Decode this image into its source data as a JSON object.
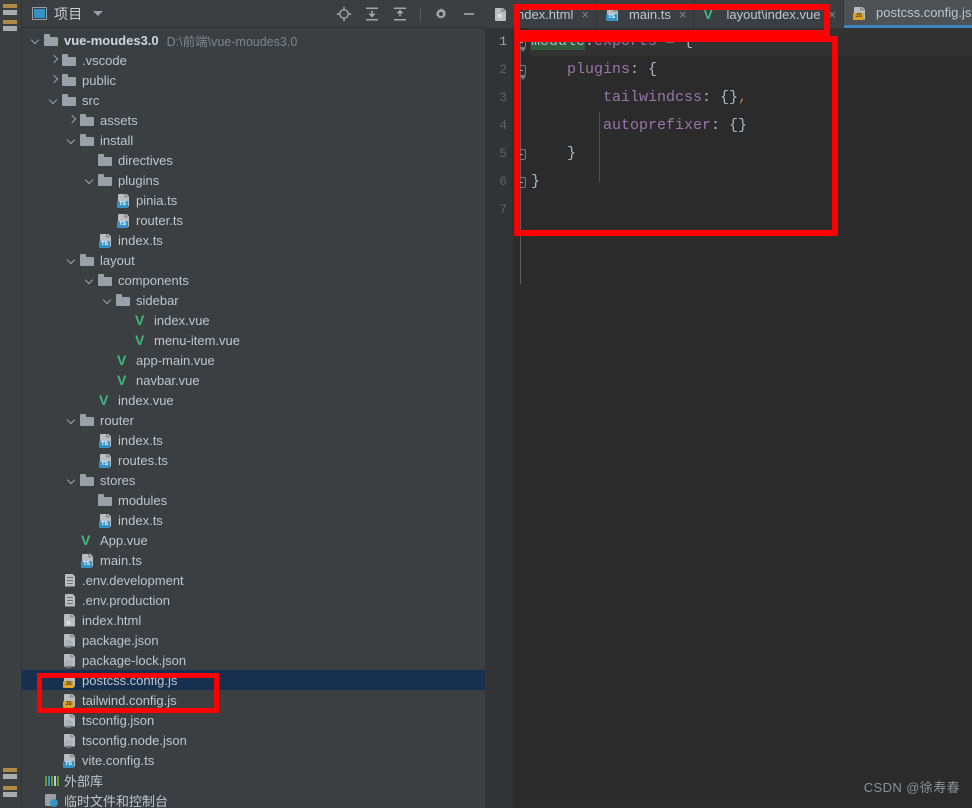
{
  "window": {
    "theme_bg": "#3c3f41",
    "editor_bg": "#2b2b2b",
    "accent": "#3d86c6",
    "annotation_color": "#ff0000"
  },
  "toolstrip": {
    "items": [
      {
        "name": "project-tool-icon"
      },
      {
        "name": "structure-tool-icon"
      },
      {
        "name": "terminal-tool-icon"
      },
      {
        "name": "problems-tool-icon"
      }
    ]
  },
  "panel": {
    "title": "项目",
    "caret": "chevron-down-icon",
    "tools": [
      {
        "name": "select-opened-file-icon",
        "title": "定位"
      },
      {
        "name": "expand-all-icon",
        "title": "全部展开"
      },
      {
        "name": "collapse-all-icon",
        "title": "全部折叠"
      },
      {
        "name": "settings-gear-icon",
        "title": "设置"
      },
      {
        "name": "hide-panel-icon",
        "title": "隐藏"
      }
    ]
  },
  "tree": {
    "rows": [
      {
        "indent": 0,
        "twisty": "open",
        "icon": "folder",
        "label": "vue-moudes3.0",
        "bold": true,
        "path": "D:\\前端\\vue-moudes3.0",
        "selected": false
      },
      {
        "indent": 1,
        "twisty": "closed",
        "icon": "folder",
        "label": ".vscode",
        "selected": false
      },
      {
        "indent": 1,
        "twisty": "closed",
        "icon": "folder",
        "label": "public",
        "selected": false
      },
      {
        "indent": 1,
        "twisty": "open",
        "icon": "folder",
        "label": "src",
        "selected": false
      },
      {
        "indent": 2,
        "twisty": "closed",
        "icon": "folder",
        "label": "assets",
        "selected": false
      },
      {
        "indent": 2,
        "twisty": "open",
        "icon": "folder",
        "label": "install",
        "selected": false
      },
      {
        "indent": 3,
        "twisty": "none",
        "icon": "folder",
        "label": "directives",
        "selected": false
      },
      {
        "indent": 3,
        "twisty": "open",
        "icon": "folder",
        "label": "plugins",
        "selected": false
      },
      {
        "indent": 4,
        "twisty": "none",
        "icon": "ts",
        "label": "pinia.ts",
        "selected": false
      },
      {
        "indent": 4,
        "twisty": "none",
        "icon": "ts",
        "label": "router.ts",
        "selected": false
      },
      {
        "indent": 3,
        "twisty": "none",
        "icon": "ts",
        "label": "index.ts",
        "selected": false
      },
      {
        "indent": 2,
        "twisty": "open",
        "icon": "folder",
        "label": "layout",
        "selected": false
      },
      {
        "indent": 3,
        "twisty": "open",
        "icon": "folder",
        "label": "components",
        "selected": false
      },
      {
        "indent": 4,
        "twisty": "open",
        "icon": "folder",
        "label": "sidebar",
        "selected": false
      },
      {
        "indent": 5,
        "twisty": "none",
        "icon": "vue",
        "label": "index.vue",
        "selected": false
      },
      {
        "indent": 5,
        "twisty": "none",
        "icon": "vue",
        "label": "menu-item.vue",
        "selected": false
      },
      {
        "indent": 4,
        "twisty": "none",
        "icon": "vue",
        "label": "app-main.vue",
        "selected": false
      },
      {
        "indent": 4,
        "twisty": "none",
        "icon": "vue",
        "label": "navbar.vue",
        "selected": false
      },
      {
        "indent": 3,
        "twisty": "none",
        "icon": "vue",
        "label": "index.vue",
        "selected": false
      },
      {
        "indent": 2,
        "twisty": "open",
        "icon": "folder",
        "label": "router",
        "selected": false
      },
      {
        "indent": 3,
        "twisty": "none",
        "icon": "ts",
        "label": "index.ts",
        "selected": false
      },
      {
        "indent": 3,
        "twisty": "none",
        "icon": "ts",
        "label": "routes.ts",
        "selected": false
      },
      {
        "indent": 2,
        "twisty": "open",
        "icon": "folder",
        "label": "stores",
        "selected": false
      },
      {
        "indent": 3,
        "twisty": "none",
        "icon": "folder",
        "label": "modules",
        "selected": false
      },
      {
        "indent": 3,
        "twisty": "none",
        "icon": "ts",
        "label": "index.ts",
        "selected": false
      },
      {
        "indent": 2,
        "twisty": "none",
        "icon": "vue",
        "label": "App.vue",
        "selected": false
      },
      {
        "indent": 2,
        "twisty": "none",
        "icon": "ts",
        "label": "main.ts",
        "selected": false
      },
      {
        "indent": 1,
        "twisty": "none",
        "icon": "env",
        "label": ".env.development",
        "selected": false
      },
      {
        "indent": 1,
        "twisty": "none",
        "icon": "env",
        "label": ".env.production",
        "selected": false
      },
      {
        "indent": 1,
        "twisty": "none",
        "icon": "html",
        "label": "index.html",
        "selected": false
      },
      {
        "indent": 1,
        "twisty": "none",
        "icon": "json",
        "label": "package.json",
        "selected": false
      },
      {
        "indent": 1,
        "twisty": "none",
        "icon": "json",
        "label": "package-lock.json",
        "selected": false
      },
      {
        "indent": 1,
        "twisty": "none",
        "icon": "js",
        "label": "postcss.config.js",
        "selected": true
      },
      {
        "indent": 1,
        "twisty": "none",
        "icon": "js",
        "label": "tailwind.config.js",
        "selected": false
      },
      {
        "indent": 1,
        "twisty": "none",
        "icon": "json",
        "label": "tsconfig.json",
        "selected": false
      },
      {
        "indent": 1,
        "twisty": "none",
        "icon": "json",
        "label": "tsconfig.node.json",
        "selected": false
      },
      {
        "indent": 1,
        "twisty": "none",
        "icon": "ts",
        "label": "vite.config.ts",
        "selected": false
      },
      {
        "indent": 0,
        "twisty": "none",
        "icon": "lib",
        "label": "外部库",
        "selected": false
      },
      {
        "indent": 0,
        "twisty": "none",
        "icon": "scratch",
        "label": "临时文件和控制台",
        "selected": false
      }
    ]
  },
  "editor": {
    "tabs": [
      {
        "label": "ndex.html",
        "icon": "html",
        "active": false,
        "close": "×"
      },
      {
        "label": "main.ts",
        "icon": "ts",
        "active": false,
        "close": "×"
      },
      {
        "label": "layout\\index.vue",
        "icon": "vue",
        "active": false,
        "close": "×"
      },
      {
        "label": "postcss.config.js",
        "icon": "js",
        "active": true,
        "close": "×"
      }
    ],
    "line_numbers": [
      "1",
      "2",
      "3",
      "4",
      "5",
      "6",
      "7"
    ],
    "current_line": 1,
    "code_lines": [
      {
        "n": 1,
        "tokens": [
          {
            "t": "module",
            "c": "hl"
          },
          {
            "t": ".",
            "c": "op"
          },
          {
            "t": "exports",
            "c": "prop"
          },
          {
            "t": " = {",
            "c": "op"
          }
        ]
      },
      {
        "n": 2,
        "tokens": [
          {
            "t": "    ",
            "c": "op"
          },
          {
            "t": "plugins",
            "c": "prop"
          },
          {
            "t": ": {",
            "c": "op"
          }
        ]
      },
      {
        "n": 3,
        "tokens": [
          {
            "t": "        ",
            "c": "op"
          },
          {
            "t": "tailwindcss",
            "c": "prop"
          },
          {
            "t": ": {}",
            "c": "op"
          },
          {
            "t": ",",
            "c": "comma"
          }
        ]
      },
      {
        "n": 4,
        "tokens": [
          {
            "t": "        ",
            "c": "op"
          },
          {
            "t": "autoprefixer",
            "c": "prop"
          },
          {
            "t": ": {}",
            "c": "op"
          }
        ]
      },
      {
        "n": 5,
        "tokens": [
          {
            "t": "    }",
            "c": "op"
          }
        ]
      },
      {
        "n": 6,
        "tokens": [
          {
            "t": "}",
            "c": "op"
          }
        ]
      },
      {
        "n": 7,
        "tokens": [
          {
            "t": "",
            "c": "op"
          }
        ]
      }
    ]
  },
  "annotations": [
    {
      "name": "tabs-highlight-box",
      "target": "editor tab row"
    },
    {
      "name": "code-highlight-box",
      "target": "postcss config code"
    },
    {
      "name": "tree-highlight-box",
      "target": "postcss.config.js and tailwind.config.js"
    }
  ],
  "watermark": {
    "text": "CSDN @徐寿春"
  }
}
